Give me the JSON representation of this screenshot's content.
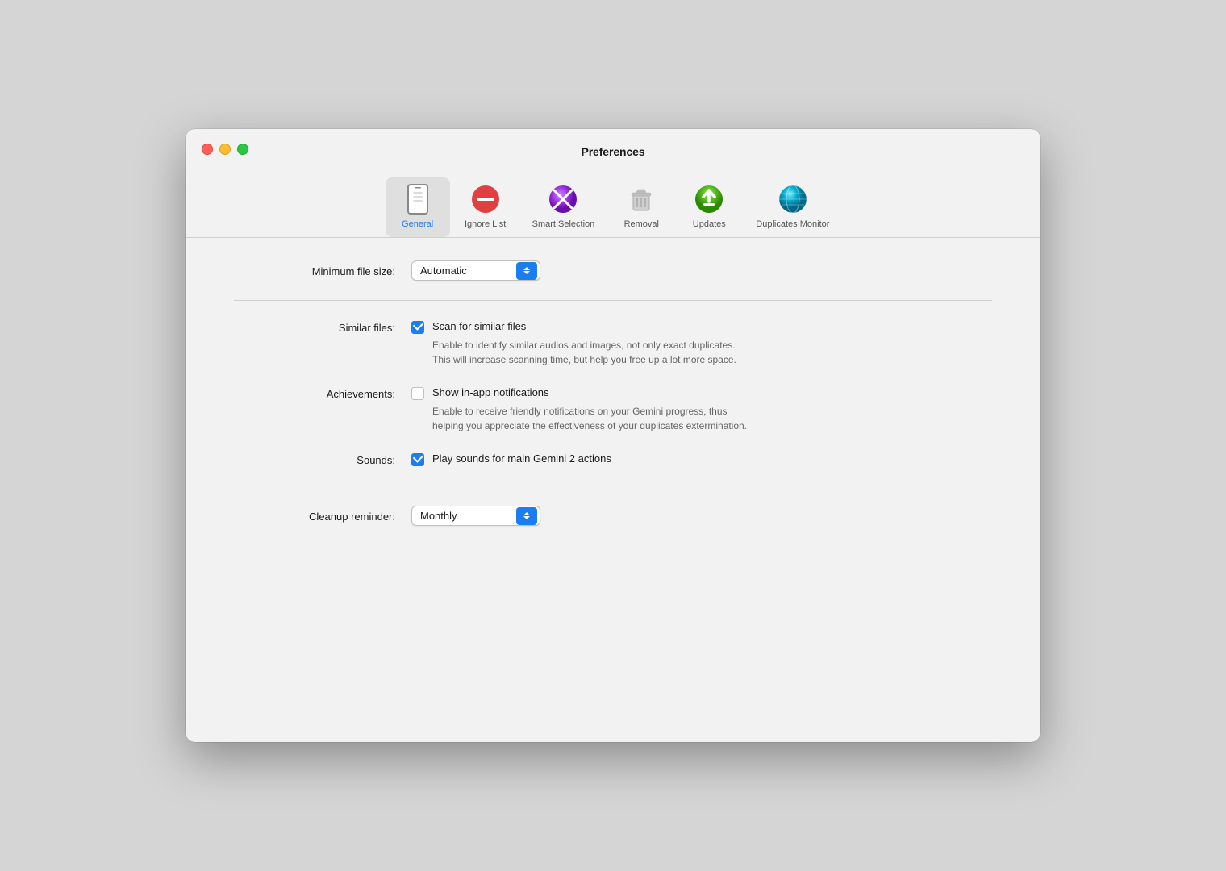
{
  "window": {
    "title": "Preferences"
  },
  "tabs": [
    {
      "id": "general",
      "label": "General",
      "active": true
    },
    {
      "id": "ignore-list",
      "label": "Ignore List",
      "active": false
    },
    {
      "id": "smart-selection",
      "label": "Smart Selection",
      "active": false
    },
    {
      "id": "removal",
      "label": "Removal",
      "active": false
    },
    {
      "id": "updates",
      "label": "Updates",
      "active": false
    },
    {
      "id": "duplicates-monitor",
      "label": "Duplicates Monitor",
      "active": false
    }
  ],
  "settings": {
    "minimum_file_size_label": "Minimum file size:",
    "minimum_file_size_value": "Automatic",
    "similar_files_label": "Similar files:",
    "similar_files_checkbox_label": "Scan for similar files",
    "similar_files_description": "Enable to identify similar audios and images, not only exact duplicates.\nThis will increase scanning time, but help you free up a lot more space.",
    "similar_files_checked": true,
    "achievements_label": "Achievements:",
    "achievements_checkbox_label": "Show in-app notifications",
    "achievements_description": "Enable to receive friendly notifications on your Gemini progress, thus\nhelping you appreciate the effectiveness of your duplicates extermination.",
    "achievements_checked": false,
    "sounds_label": "Sounds:",
    "sounds_checkbox_label": "Play sounds for main Gemini 2 actions",
    "sounds_checked": true,
    "cleanup_reminder_label": "Cleanup reminder:",
    "cleanup_reminder_value": "Monthly"
  },
  "icons": {
    "close": "close-icon",
    "minimize": "minimize-icon",
    "maximize": "maximize-icon"
  }
}
